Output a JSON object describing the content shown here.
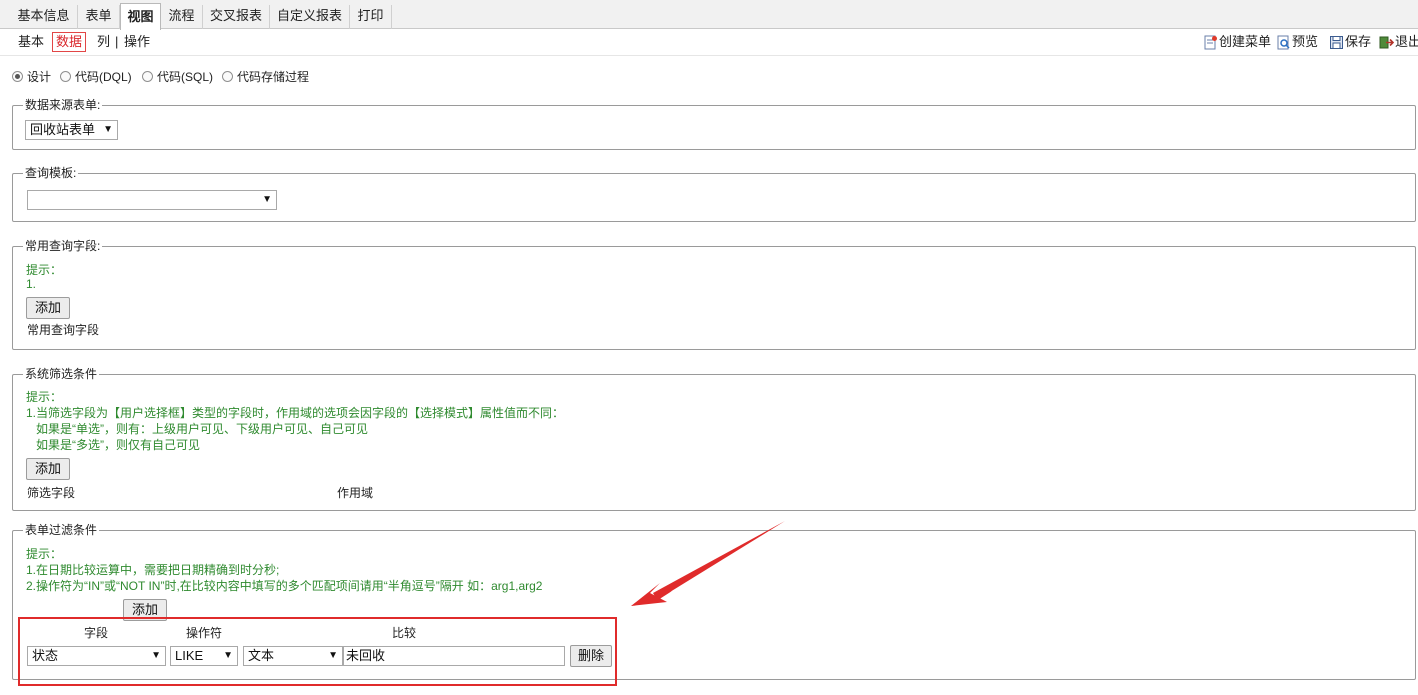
{
  "top_tabs": [
    "基本信息",
    "表单",
    "视图",
    "流程",
    "交叉报表",
    "自定义报表",
    "打印"
  ],
  "active_top_tab": "视图",
  "sub_tabs": {
    "basic": "基本",
    "data": "数据",
    "column": "列",
    "separator": "|",
    "action": "操作"
  },
  "toolbar": {
    "create_menu": "创建菜单",
    "preview": "预览",
    "save": "保存",
    "exit": "退出"
  },
  "modes": [
    "设计",
    "代码(DQL)",
    "代码(SQL)",
    "代码存储过程"
  ],
  "selected_mode": "设计",
  "datasource": {
    "legend": "数据来源表单:",
    "selected": "回收站表单"
  },
  "query_template": {
    "legend": "查询模板:",
    "selected": ""
  },
  "common_fields": {
    "legend": "常用查询字段:",
    "hint_title": "提示：",
    "hint_lines": [
      "1."
    ],
    "add_label": "添加",
    "column_label": "常用查询字段"
  },
  "system_filter": {
    "legend": "系统筛选条件",
    "hint_title": "提示：",
    "hint_lines": [
      "1.当筛选字段为【用户选择框】类型的字段时，作用域的选项会因字段的【选择模式】属性值而不同：",
      "   如果是“单选”，则有：上级用户可见、下级用户可见、自己可见",
      "   如果是“多选”，则仅有自己可见"
    ],
    "add_label": "添加",
    "col_field": "筛选字段",
    "col_scope": "作用域"
  },
  "form_filter": {
    "legend": "表单过滤条件",
    "hint_title": "提示：",
    "hint_lines": [
      "1.在日期比较运算中，需要把日期精确到时分秒;",
      "2.操作符为“IN”或“NOT IN”时,在比较内容中填写的多个匹配项间请用“半角逗号”隔开 如：arg1,arg2"
    ],
    "add_label": "添加",
    "col_field": "字段",
    "col_operator": "操作符",
    "col_compare": "比较",
    "row": {
      "field": "状态",
      "operator": "LIKE",
      "type": "文本",
      "value": "未回收",
      "delete_label": "删除"
    }
  },
  "colors": {
    "active_subtab": "#d9262b",
    "hint_text": "#2f8a2f",
    "annotation_red": "#e02b2b"
  }
}
